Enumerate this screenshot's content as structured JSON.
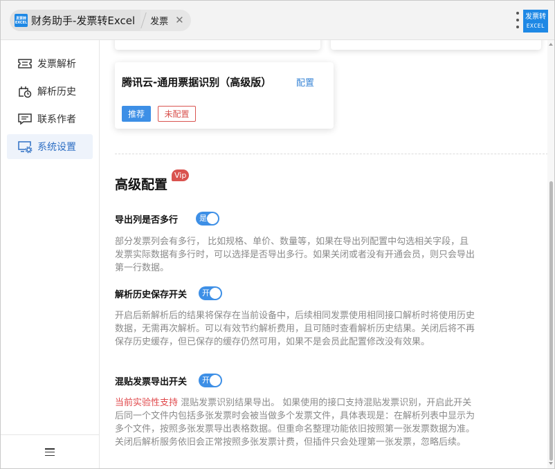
{
  "window": {
    "app_title": "财务助手-发票转Excel",
    "logo_text_line1": "发票转",
    "logo_text_line2": "EXCEL",
    "sub_tab": "发票"
  },
  "corner_logo": {
    "line1": "发票转",
    "line2": "EXCEL"
  },
  "sidebar": {
    "items": [
      {
        "label": "发票解析",
        "icon": "ticket-icon",
        "active": false
      },
      {
        "label": "解析历史",
        "icon": "history-icon",
        "active": false
      },
      {
        "label": "联系作者",
        "icon": "chat-icon",
        "active": false
      },
      {
        "label": "系统设置",
        "icon": "settings-monitor-icon",
        "active": true
      }
    ],
    "menu_icon": "hamburger-icon"
  },
  "card": {
    "title": "腾讯云-通用票据识别（高级版）",
    "config_link": "配置",
    "tag_recommended": "推荐",
    "tag_status": "未配置"
  },
  "advanced": {
    "title": "高级配置",
    "vip_badge": "Vip",
    "options": [
      {
        "label": "导出列是否多行",
        "switch_text": "是",
        "enabled": true,
        "desc": "部分发票列会有多行， 比如规格、单价、数量等，如果在导出列配置中勾选相关字段，且发票实际数据有多行时，可以选择是否导出多行。如果关闭或者没有开通会员，则只会导出第一行数据。"
      },
      {
        "label": "解析历史保存开关",
        "switch_text": "开",
        "enabled": true,
        "desc": "开启后新解析后的结果将保存在当前设备中，后续相同发票使用相同接口解析时将使用历史数据，无需再次解析。可以有效节约解析费用，且可随时查看解析历史结果。关闭后将不再保存历史缓存，但已保存的缓存仍然可用，如果不是会员此配置修改没有效果。"
      },
      {
        "label": "混贴发票导出开关",
        "switch_text": "开",
        "enabled": true,
        "desc_warning": "当前实验性支持",
        "desc": " 混贴发票识别结果导出。 如果使用的接口支持混贴发票识别，开启此开关后同一个文件内包括多张发票时会被当做多个发票文件，具体表现是：在解析列表中显示为多个文件，按照多张发票导出表格数据。但重命名整理功能依旧按照第一张发票数据为准。关闭后解析服务依旧会正常按照多张发票计费，但插件只会处理第一张发票，忽略后续。"
      }
    ]
  },
  "colors": {
    "accent": "#3d8fe6",
    "danger": "#d9534f",
    "active_nav_bg": "#eef3fb"
  }
}
